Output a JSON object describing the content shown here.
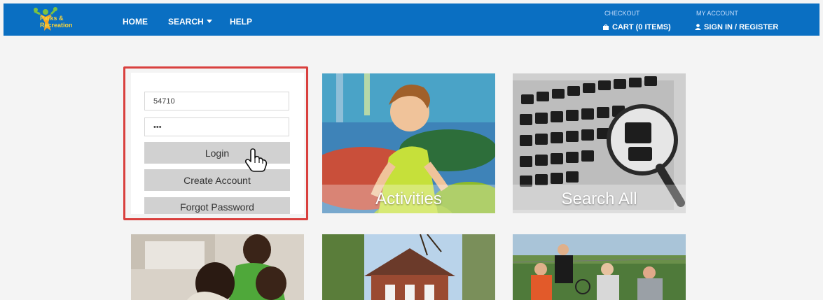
{
  "header": {
    "logo_text_line1": "Parks &",
    "logo_text_line2": "Recreation",
    "nav": {
      "home": "HOME",
      "search": "SEARCH",
      "help": "HELP"
    },
    "checkout_label": "CHECKOUT",
    "cart": "CART (0 ITEMS)",
    "account_label": "MY ACCOUNT",
    "sign_in": "SIGN IN / REGISTER"
  },
  "login": {
    "username_value": "54710",
    "password_value": "•••",
    "login_button": "Login",
    "create_account_button": "Create Account",
    "forgot_password_button": "Forgot Password"
  },
  "tiles": {
    "activities": "Activities",
    "search_all": "Search All"
  },
  "colors": {
    "header_bg": "#0a6fc2",
    "highlight": "#d9403e",
    "button_bg": "#d1d1d1"
  }
}
